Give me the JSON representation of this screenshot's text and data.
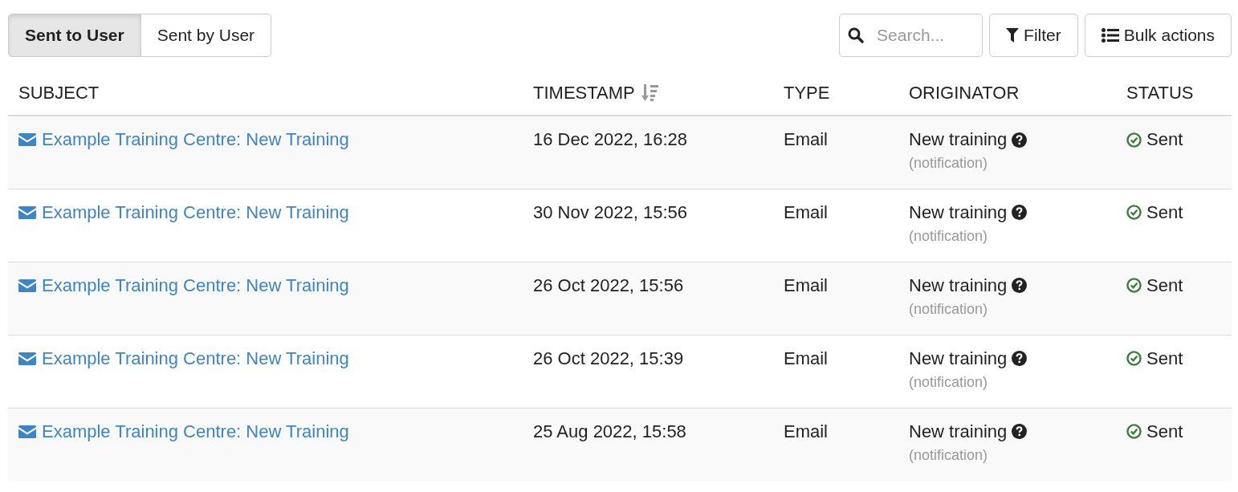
{
  "tabs": [
    {
      "label": "Sent to User",
      "selected": true
    },
    {
      "label": "Sent by User",
      "selected": false
    }
  ],
  "search": {
    "placeholder": "Search..."
  },
  "buttons": [
    {
      "kind": "filter",
      "label": "Filter"
    },
    {
      "kind": "bulk",
      "label": "Bulk actions"
    }
  ],
  "table": {
    "columns": [
      {
        "label": "SUBJECT",
        "sorted": false
      },
      {
        "label": "TIMESTAMP",
        "sorted": true
      },
      {
        "label": "TYPE",
        "sorted": false
      },
      {
        "label": "ORIGINATOR",
        "sorted": false
      },
      {
        "label": "STATUS",
        "sorted": false
      }
    ],
    "rows": [
      {
        "subject": "Example Training Centre: New Training",
        "timestamp": "16 Dec 2022, 16:28",
        "type": "Email",
        "originator": "New training",
        "originator_note": "(notification)",
        "status": "Sent"
      },
      {
        "subject": "Example Training Centre: New Training",
        "timestamp": "30 Nov 2022, 15:56",
        "type": "Email",
        "originator": "New training",
        "originator_note": "(notification)",
        "status": "Sent"
      },
      {
        "subject": "Example Training Centre: New Training",
        "timestamp": "26 Oct 2022, 15:56",
        "type": "Email",
        "originator": "New training",
        "originator_note": "(notification)",
        "status": "Sent"
      },
      {
        "subject": "Example Training Centre: New Training",
        "timestamp": "26 Oct 2022, 15:39",
        "type": "Email",
        "originator": "New training",
        "originator_note": "(notification)",
        "status": "Sent"
      },
      {
        "subject": "Example Training Centre: New Training",
        "timestamp": "25 Aug 2022, 15:58",
        "type": "Email",
        "originator": "New training",
        "originator_note": "(notification)",
        "status": "Sent"
      }
    ]
  }
}
